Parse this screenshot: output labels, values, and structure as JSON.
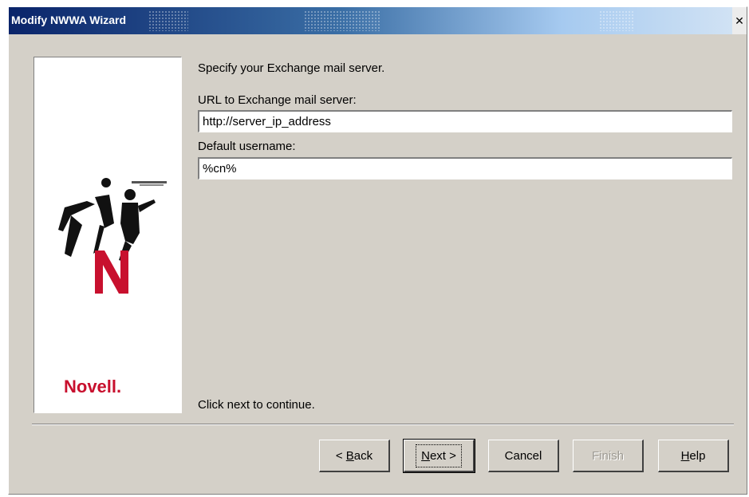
{
  "window": {
    "title": "Modify NWWA Wizard",
    "close_glyph": "✕"
  },
  "sidebar": {
    "logo_text": "Novell.",
    "logo_icon": "novell-n-logo",
    "brand_color": "#c8102e"
  },
  "content": {
    "intro": "Specify your Exchange mail server.",
    "url_label": "URL to Exchange mail server:",
    "url_value": "http://server_ip_address",
    "username_label": "Default username:",
    "username_value": "%cn%",
    "footnote": "Click next to continue."
  },
  "buttons": {
    "back": {
      "prefix": "< ",
      "access_key": "B",
      "rest": "ack"
    },
    "next": {
      "access_key": "N",
      "rest": "ext >"
    },
    "cancel": "Cancel",
    "finish": "Finish",
    "help": {
      "access_key": "H",
      "rest": "elp"
    }
  }
}
